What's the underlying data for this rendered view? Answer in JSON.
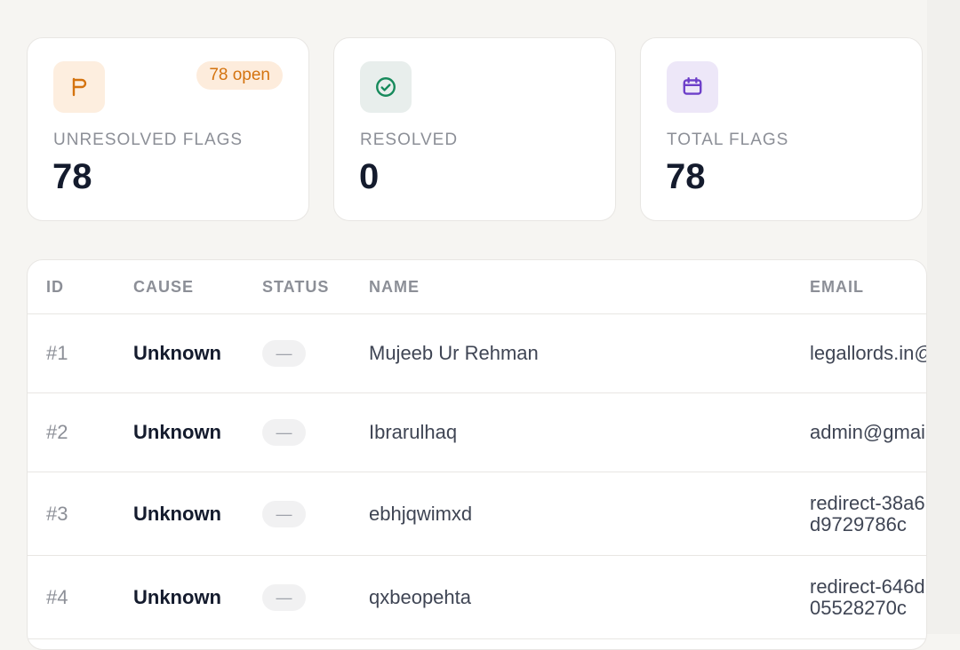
{
  "cards": [
    {
      "icon": "flag-icon",
      "label": "UNRESOLVED FLAGS",
      "value": "78",
      "badge": "78 open",
      "icon_bg": "#fdeedf",
      "icon_color": "#d4730f"
    },
    {
      "icon": "check-circle-icon",
      "label": "RESOLVED",
      "value": "0",
      "icon_bg": "#e8eeec",
      "icon_color": "#168a5b"
    },
    {
      "icon": "calendar-icon",
      "label": "TOTAL FLAGS",
      "value": "78",
      "icon_bg": "#ede7f8",
      "icon_color": "#6d3fc9"
    }
  ],
  "table": {
    "columns": [
      "ID",
      "CAUSE",
      "STATUS",
      "NAME",
      "EMAIL"
    ],
    "rows": [
      {
        "id": "#1",
        "cause": "Unknown",
        "status": "—",
        "name": "Mujeeb Ur Rehman",
        "email": "legallords.in@gm"
      },
      {
        "id": "#2",
        "cause": "Unknown",
        "status": "—",
        "name": "Ibrarulhaq",
        "email": "admin@gmail.co"
      },
      {
        "id": "#3",
        "cause": "Unknown",
        "status": "—",
        "name": "ebhjqwimxd",
        "email": "redirect-38a6d9729786c"
      },
      {
        "id": "#4",
        "cause": "Unknown",
        "status": "—",
        "name": "qxbeopehta",
        "email": "redirect-646d05528270c"
      }
    ]
  }
}
